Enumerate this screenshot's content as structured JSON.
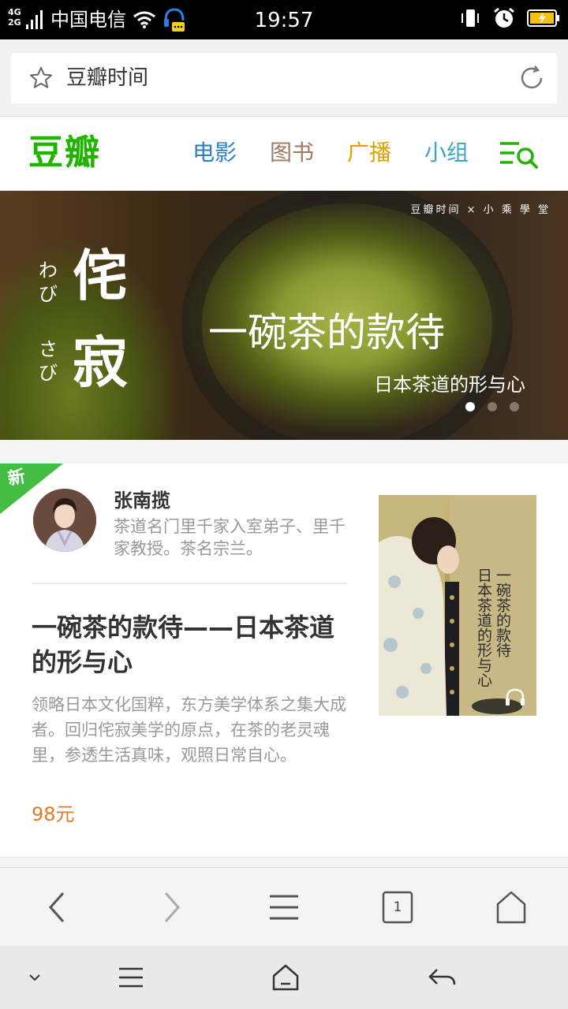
{
  "status_bar": {
    "network_top": "4G",
    "network_bottom": "2G",
    "carrier": "中国电信",
    "time": "19:57"
  },
  "browser": {
    "page_title": "豆瓣时间",
    "star_icon": "star-outline-icon",
    "reload_icon": "reload-icon"
  },
  "site_header": {
    "logo": "豆瓣",
    "nav": [
      {
        "label": "电影",
        "color": "#2e7fc5"
      },
      {
        "label": "图书",
        "color": "#9b7b66"
      },
      {
        "label": "广播",
        "color": "#e0a100"
      },
      {
        "label": "小组",
        "color": "#3aa8c8"
      }
    ],
    "menu_search_icon": "menu-search-icon",
    "brand_color": "#1fb400"
  },
  "banner": {
    "partner_line": "豆瓣时间 × 小 乘 學 堂",
    "kana_1": "わび",
    "kana_2": "さび",
    "kanji_1": "侘",
    "kanji_2": "寂",
    "headline": "一碗茶的款待",
    "subline": "日本茶道的形与心",
    "slide_count": 3,
    "active_slide": 1
  },
  "card": {
    "badge": "新",
    "author_name": "张南揽",
    "author_desc": "茶道名门里千家入室弟子、里千家教授。茶名宗兰。",
    "title": "一碗茶的款待——日本茶道的形与心",
    "description": "领略日本文化国粹，东方美学体系之集大成者。回归侘寂美学的原点，在茶的老灵魂里，参透生活真味，观照日常自心。",
    "price": "98元",
    "cover_title_1": "一碗茶的款待",
    "cover_title_2": "日本茶道的形与心",
    "price_color": "#e07a2b"
  },
  "browser_toolbar": {
    "tab_count": "1",
    "icons": [
      "back-icon",
      "forward-icon",
      "menu-icon",
      "tabs-icon",
      "home-icon"
    ]
  },
  "system_nav": {
    "icons": [
      "collapse-icon",
      "menu-icon",
      "home-icon",
      "return-icon"
    ]
  }
}
